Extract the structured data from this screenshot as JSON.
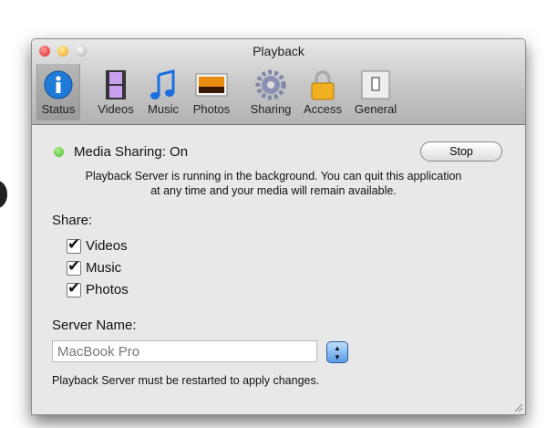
{
  "window": {
    "title": "Playback"
  },
  "toolbar": {
    "items": [
      {
        "label": "Status",
        "icon": "info-icon",
        "selected": true
      },
      {
        "label": "Videos",
        "icon": "film-icon"
      },
      {
        "label": "Music",
        "icon": "music-note-icon"
      },
      {
        "label": "Photos",
        "icon": "photo-icon"
      },
      {
        "label": "Sharing",
        "icon": "gear-icon"
      },
      {
        "label": "Access",
        "icon": "lock-icon"
      },
      {
        "label": "General",
        "icon": "switch-icon"
      }
    ]
  },
  "status": {
    "text": "Media Sharing: On",
    "color": "#3fbf2a",
    "stop_label": "Stop",
    "description_1": "Playback Server is running in the background. You can quit this application",
    "description_2": "at any time and your media will remain available."
  },
  "share": {
    "label": "Share:",
    "items": [
      {
        "label": "Videos",
        "checked": true
      },
      {
        "label": "Music",
        "checked": true
      },
      {
        "label": "Photos",
        "checked": true
      }
    ]
  },
  "server": {
    "label": "Server Name:",
    "value": "MacBook Pro",
    "note": "Playback Server must be restarted to apply changes."
  }
}
